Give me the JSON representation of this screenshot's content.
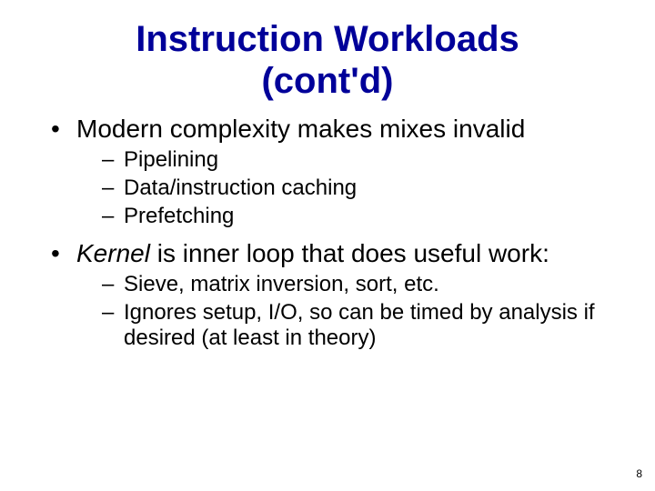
{
  "title_line1": "Instruction Workloads",
  "title_line2": "(cont'd)",
  "bullets": {
    "b1": "Modern complexity makes mixes invalid",
    "b1_sub": {
      "s1": "Pipelining",
      "s2": "Data/instruction caching",
      "s3": "Prefetching"
    },
    "b2_italic": "Kernel",
    "b2_rest": " is inner loop that does useful work:",
    "b2_sub": {
      "s1": "Sieve, matrix inversion, sort, etc.",
      "s2": "Ignores setup, I/O, so can be timed by analysis if desired (at least in theory)"
    }
  },
  "page_number": "8"
}
